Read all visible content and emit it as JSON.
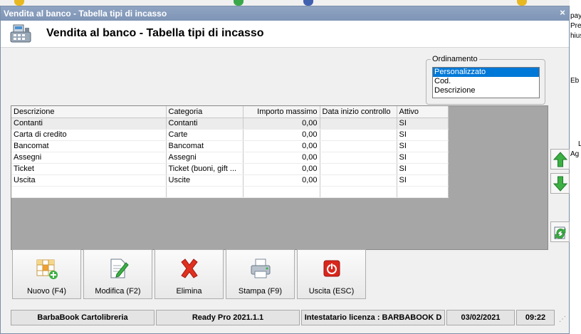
{
  "window": {
    "title": "Vendita al banco - Tabella tipi di incasso",
    "close_glyph": "×"
  },
  "header": {
    "title": "Vendita al banco - Tabella tipi di incasso",
    "icon": "cash-register-icon"
  },
  "sort": {
    "legend": "Ordinamento",
    "options": [
      "Personalizzato",
      "Cod.",
      "Descrizione"
    ],
    "selected": "Personalizzato"
  },
  "grid": {
    "columns": [
      "Descrizione",
      "Categoria",
      "Importo massimo",
      "Data inizio controllo",
      "Attivo"
    ],
    "rows": [
      [
        "Contanti",
        "Contanti",
        "0,00",
        "",
        "SI"
      ],
      [
        "Carta di credito",
        "Carte",
        "0,00",
        "",
        "SI"
      ],
      [
        "Bancomat",
        "Bancomat",
        "0,00",
        "",
        "SI"
      ],
      [
        "Assegni",
        "Assegni",
        "0,00",
        "",
        "SI"
      ],
      [
        "Ticket",
        "Ticket (buoni, gift ...",
        "0,00",
        "",
        "SI"
      ],
      [
        "Uscita",
        "Uscite",
        "0,00",
        "",
        "SI"
      ]
    ]
  },
  "side_buttons": {
    "up": "arrow-up-icon",
    "down": "arrow-down-icon",
    "refresh": "refresh-icon"
  },
  "buttons": {
    "new": "Nuovo (F4)",
    "edit": "Modifica (F2)",
    "delete": "Elimina",
    "print": "Stampa (F9)",
    "exit": "Uscita (ESC)"
  },
  "status": {
    "company": "BarbaBook Cartolibreria",
    "version": "Ready Pro 2021.1.1",
    "license": "Intestatario licenza : BARBABOOK D",
    "date": "03/02/2021",
    "time": "09:22"
  },
  "background_text": [
    "pay",
    "Pre",
    "hius",
    "Eb",
    "L",
    "Ag"
  ],
  "colors": {
    "titlebar": "#8fa4c2",
    "selection": "#0078d7",
    "grid_background": "#a6a6a6",
    "arrow_green": "#3cb043",
    "delete_red": "#e0301e",
    "exit_red": "#d9261c"
  }
}
